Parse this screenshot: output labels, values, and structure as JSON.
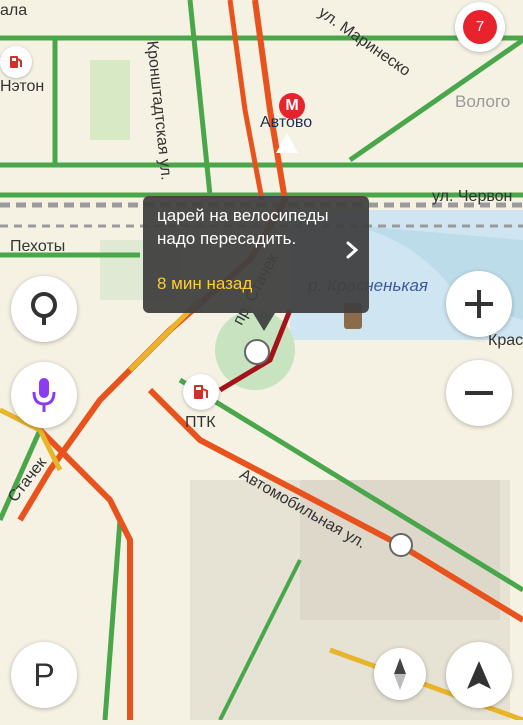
{
  "map": {
    "labels": {
      "station_gas_top": "Нэтон",
      "metro": "Автово",
      "street_kronshtadtskaya": "Кронштадтская ул.",
      "street_marinesko": "ул. Маринеско",
      "district_vologda": "Волого",
      "street_chervon": "ул. Червон",
      "avenue_stachek_top": "пр. Стачек",
      "street_pekhoty": "Пехоты",
      "avenue_stachek_bottom": "Стачек",
      "river": "р. Красненькая",
      "kras": "Крас",
      "ptk": "ПТК",
      "street_avtomobilnaya": "Автомобильная ул.",
      "street_top_left": "ала"
    },
    "colors": {
      "background": "#f5f1e3",
      "road_green": "#4aa64a",
      "road_orange": "#e8531d",
      "road_yellow": "#e8b52a",
      "road_dark_red": "#a3141a",
      "water": "#b5d8ea",
      "park": "#c8e3bf"
    }
  },
  "popup": {
    "text": "царей на велосипеды надо пересадить.",
    "time_ago": "8 мин назад",
    "icon": "chevron-right-icon"
  },
  "controls": {
    "notification_count": "7",
    "search_icon": "search-icon",
    "voice_icon": "microphone-icon",
    "parking_label": "P",
    "zoom_in_icon": "plus-icon",
    "zoom_out_icon": "minus-icon",
    "compass_icon": "compass-icon",
    "location_icon": "navigation-arrow-icon"
  }
}
